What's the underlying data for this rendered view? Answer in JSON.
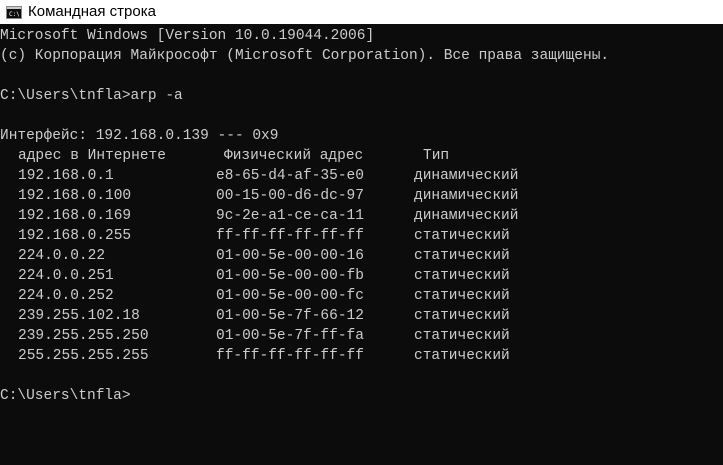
{
  "window": {
    "title": "Командная строка",
    "icon": "cmd-console-icon"
  },
  "console": {
    "banner_line1": "Microsoft Windows [Version 10.0.19044.2006]",
    "banner_line2": "(c) Корпорация Майкрософт (Microsoft Corporation). Все права защищены.",
    "command_line": "C:\\Users\\tnfla>arp -a",
    "interface_line": "Интерфейс: 192.168.0.139 --- 0x9",
    "table": {
      "headers": [
        "адрес в Интернете",
        "Физический адрес",
        "Тип"
      ],
      "rows": [
        [
          "192.168.0.1",
          "e8-65-d4-af-35-e0",
          "динамический"
        ],
        [
          "192.168.0.100",
          "00-15-00-d6-dc-97",
          "динамический"
        ],
        [
          "192.168.0.169",
          "9c-2e-a1-ce-ca-11",
          "динамический"
        ],
        [
          "192.168.0.255",
          "ff-ff-ff-ff-ff-ff",
          "статический"
        ],
        [
          "224.0.0.22",
          "01-00-5e-00-00-16",
          "статический"
        ],
        [
          "224.0.0.251",
          "01-00-5e-00-00-fb",
          "статический"
        ],
        [
          "224.0.0.252",
          "01-00-5e-00-00-fc",
          "статический"
        ],
        [
          "239.255.102.18",
          "01-00-5e-7f-66-12",
          "статический"
        ],
        [
          "239.255.255.250",
          "01-00-5e-7f-ff-fa",
          "статический"
        ],
        [
          "255.255.255.255",
          "ff-ff-ff-ff-ff-ff",
          "статический"
        ]
      ]
    },
    "prompt_line": "C:\\Users\\tnfla>"
  },
  "colors": {
    "background": "#0c0c0c",
    "text": "#cccccc",
    "titlebar": "#ffffff"
  }
}
